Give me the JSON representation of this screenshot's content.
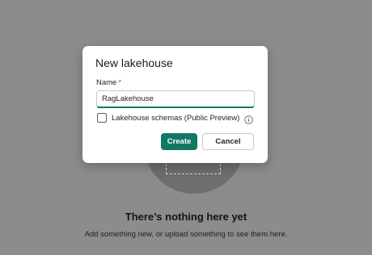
{
  "background": {
    "empty_title": "There’s nothing here yet",
    "empty_subtitle": "Add something new, or upload something to see them here."
  },
  "dialog": {
    "title": "New lakehouse",
    "name_label": "Name",
    "required_marker": "*",
    "name_value": "RagLakehouse",
    "schemas_checkbox_label": "Lakehouse schemas (Public Preview)",
    "schemas_checked": false,
    "create_label": "Create",
    "cancel_label": "Cancel"
  },
  "colors": {
    "accent": "#117865",
    "required": "#c4314b",
    "overlay": "#8c8c8c"
  },
  "icons": {
    "info": "info-icon"
  }
}
